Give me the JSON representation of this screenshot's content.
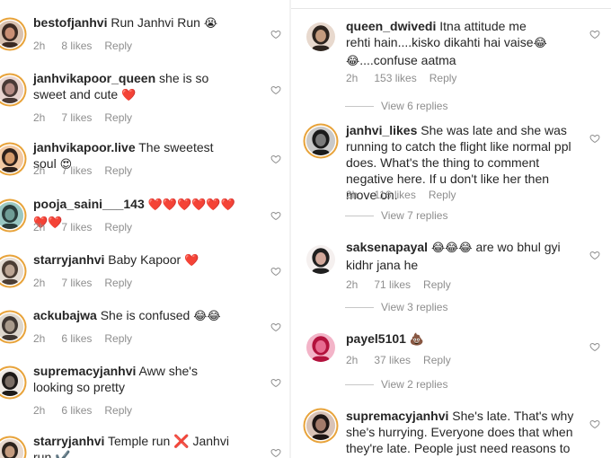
{
  "left_comments": [
    {
      "username": "bestofjanhvi",
      "text": "Run Janhvi Run",
      "emoji": "😭",
      "time": "2h",
      "likes": "8 likes",
      "reply": "Reply"
    },
    {
      "username": "janhvikapoor_queen",
      "text": "she is so sweet and cute",
      "emoji": "❤️",
      "time": "2h",
      "likes": "7 likes",
      "reply": "Reply"
    },
    {
      "username": "janhvikapoor.live",
      "text": "The sweetest soul",
      "emoji": "😍",
      "time": "2h",
      "likes": "7 likes",
      "reply": "Reply"
    },
    {
      "username": "pooja_saini___143",
      "text": "",
      "emoji": "❤️❤️❤️❤️❤️❤️❤️❤️",
      "time": "2h",
      "likes": "7 likes",
      "reply": "Reply"
    },
    {
      "username": "starryjanhvi",
      "text": "Baby Kapoor",
      "emoji": "❤️",
      "time": "2h",
      "likes": "7 likes",
      "reply": "Reply"
    },
    {
      "username": "ackubajwa",
      "text": "She is confused",
      "emoji": "😂😂",
      "time": "2h",
      "likes": "6 likes",
      "reply": "Reply"
    },
    {
      "username": "supremacyjanhvi",
      "text": "Aww she's looking so pretty",
      "emoji": "",
      "time": "2h",
      "likes": "6 likes",
      "reply": "Reply"
    },
    {
      "username": "starryjanhvi",
      "text": "Temple run ❌ Janhvi run ✔️",
      "emoji": "",
      "time": "",
      "likes": "",
      "reply": ""
    }
  ],
  "right_comments": [
    {
      "username": "queen_dwivedi",
      "text": "Itna attitude me rehti hain....kisko dikahti hai vaise",
      "text2": "....confuse aatma",
      "emoji": "😂",
      "time": "2h",
      "likes": "153 likes",
      "reply": "Reply",
      "view_replies": "View 6 replies"
    },
    {
      "username": "janhvi_likes",
      "text": "She was late  and she was running to catch the flight like normal ppl does. What's the thing to comment negative here. If u don't like her then move on.",
      "time": "2h",
      "likes": "116 likes",
      "reply": "Reply",
      "view_replies": "View 7 replies"
    },
    {
      "username": "saksenapayal",
      "emoji": "😂😂😂",
      "text": "are wo bhul gyi kidhr jana he",
      "time": "2h",
      "likes": "71 likes",
      "reply": "Reply",
      "view_replies": "View 3 replies"
    },
    {
      "username": "payel5101",
      "emoji": "💩",
      "text": "",
      "time": "2h",
      "likes": "37 likes",
      "reply": "Reply",
      "view_replies": "View 2 replies"
    },
    {
      "username": "supremacyjanhvi",
      "text": "She's late. That's why she's hurrying. Everyone does that when they're late. People just need reasons to hate her",
      "time": "",
      "likes": "",
      "reply": ""
    }
  ],
  "colors": {
    "ring": "#e8a33a",
    "muted": "#8e8e8e",
    "text": "#262626"
  }
}
